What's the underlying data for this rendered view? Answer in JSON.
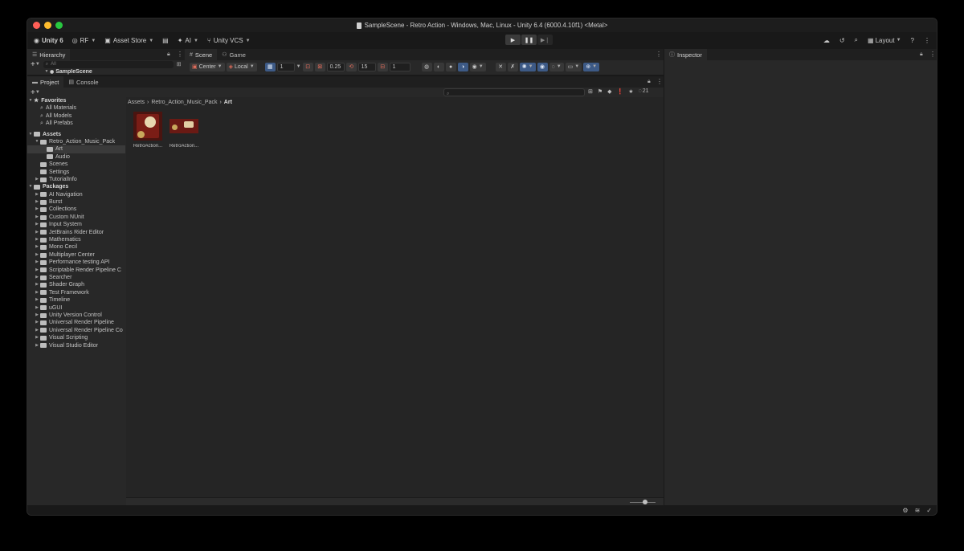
{
  "window": {
    "title": "SampleScene - Retro Action - Windows, Mac, Linux - Unity 6.4 (6000.4.10f1) <Metal>",
    "traffic_colors": [
      "#ff5f57",
      "#febc2e",
      "#28c840"
    ]
  },
  "toolbar": {
    "account": "Unity 6",
    "user": "RF",
    "asset_store": "Asset Store",
    "ai": "AI",
    "vcs": "Unity VCS",
    "layout": "Layout"
  },
  "hierarchy": {
    "tab": "Hierarchy",
    "search_placeholder": "All",
    "scene_name": "SampleScene"
  },
  "scene": {
    "tabs": [
      "Scene",
      "Game"
    ],
    "pivot": "Center",
    "space": "Local",
    "grid_value": "1",
    "snap_value": "0.25",
    "rotate_value": "15",
    "scale_value": "1"
  },
  "inspector": {
    "tab": "Inspector"
  },
  "project": {
    "tabs": [
      "Project",
      "Console"
    ],
    "hidden_count": "21",
    "breadcrumb": [
      "Assets",
      "Retro_Action_Music_Pack",
      "Art"
    ],
    "favorites": {
      "label": "Favorites",
      "items": [
        "All Materials",
        "All Models",
        "All Prefabs"
      ]
    },
    "assets": {
      "label": "Assets",
      "pack": "Retro_Action_Music_Pack",
      "pack_children": [
        "Art",
        "Audio"
      ],
      "folders": [
        "Scenes",
        "Settings",
        "TutorialInfo"
      ]
    },
    "packages": {
      "label": "Packages",
      "items": [
        "AI Navigation",
        "Burst",
        "Collections",
        "Custom NUnit",
        "Input System",
        "JetBrains Rider Editor",
        "Mathematics",
        "Mono Cecil",
        "Multiplayer Center",
        "Performance testing API",
        "Scriptable Render Pipeline C",
        "Searcher",
        "Shader Graph",
        "Test Framework",
        "Timeline",
        "uGUI",
        "Unity Version Control",
        "Universal Render Pipeline",
        "Universal Render Pipeline Co",
        "Visual Scripting",
        "Visual Studio Editor"
      ]
    },
    "asset_items": [
      {
        "label": "RetroAction..."
      },
      {
        "label": "RetroAction..."
      }
    ]
  }
}
